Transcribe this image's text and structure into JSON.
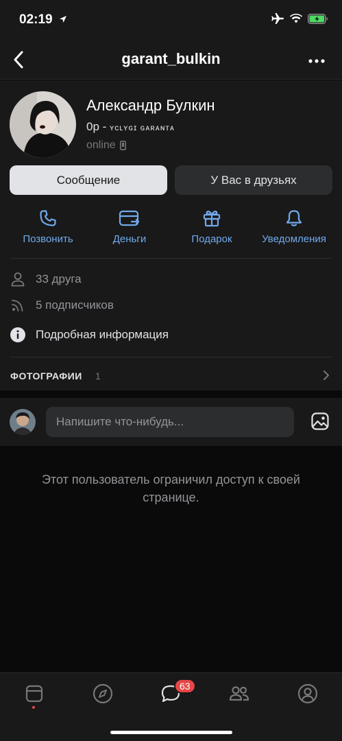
{
  "status_bar": {
    "time": "02:19"
  },
  "header": {
    "title": "garant_bulkin"
  },
  "profile": {
    "name": "Александр Булкин",
    "status_prefix": "0р - ",
    "status_text": "ʏcʟʏɢɪ ɢᴀʀᴀɴᴛᴀ",
    "online": "online"
  },
  "buttons": {
    "message": "Сообщение",
    "friends": "У Вас в друзьях"
  },
  "actions": [
    {
      "label": "Позвонить",
      "icon": "phone-icon"
    },
    {
      "label": "Деньги",
      "icon": "money-card-icon"
    },
    {
      "label": "Подарок",
      "icon": "gift-icon"
    },
    {
      "label": "Уведомления",
      "icon": "bell-icon"
    }
  ],
  "info": {
    "friends": "33 друга",
    "followers": "5 подписчиков",
    "details": "Подробная информация"
  },
  "photos": {
    "title": "ФОТОГРАФИИ",
    "count": "1"
  },
  "composer": {
    "placeholder": "Напишите что-нибудь..."
  },
  "restricted_message": "Этот пользователь ограничил доступ к своей странице.",
  "tabbar": {
    "messages_badge": "63"
  },
  "colors": {
    "accent": "#71aaeb",
    "badge": "#e64646",
    "background": "#19191a"
  }
}
